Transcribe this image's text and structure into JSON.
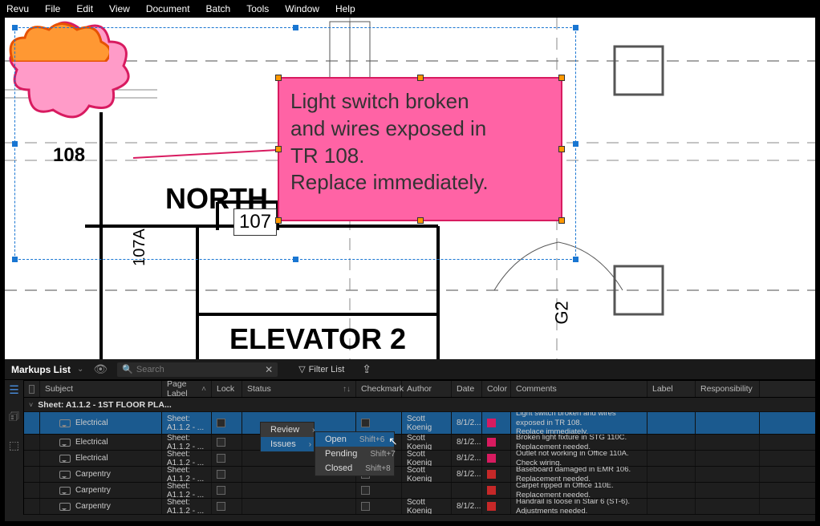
{
  "menu": [
    "Revu",
    "File",
    "Edit",
    "View",
    "Document",
    "Batch",
    "Tools",
    "Window",
    "Help"
  ],
  "canvas": {
    "cloud_label": "108",
    "label_107": "107",
    "label_107a": "107A",
    "label_north": "NORTH I",
    "label_elevator": "ELEVATOR 2",
    "label_g2": "G2",
    "callout_text_l1": "Light switch broken",
    "callout_text_l2": "and wires exposed in",
    "callout_text_l3": "TR 108.",
    "callout_text_l4": "Replace immediately."
  },
  "panel": {
    "title": "Markups List",
    "search_placeholder": "Search",
    "filter_label": "Filter List",
    "columns": {
      "subject": "Subject",
      "page": "Page Label",
      "lock": "Lock",
      "status": "Status",
      "checkmark": "Checkmark",
      "author": "Author",
      "date": "Date",
      "color": "Color",
      "comments": "Comments",
      "label": "Label",
      "responsibility": "Responsibility"
    },
    "group_label": "Sheet: A1.1.2 - 1ST FLOOR PLA...",
    "rows": [
      {
        "subject": "Electrical",
        "page": "Sheet: A1.1.2 - ...",
        "author": "Scott Koenig",
        "date": "8/1/2...",
        "color": "#d81b60",
        "comments": "Light switch broken and wires exposed in TR 108.\nReplace immediately."
      },
      {
        "subject": "Electrical",
        "page": "Sheet: A1.1.2 - ...",
        "author": "Scott Koenig",
        "date": "8/1/2...",
        "color": "#d81b60",
        "comments": "Broken light fixture in STG 110C. Replacement needed."
      },
      {
        "subject": "Electrical",
        "page": "Sheet: A1.1.2 - ...",
        "author": "Scott Koenig",
        "date": "8/1/2...",
        "color": "#d81b60",
        "comments": "Outlet not working in Office 110A. Check wiring."
      },
      {
        "subject": "Carpentry",
        "page": "Sheet: A1.1.2 - ...",
        "author": "Scott Koenig",
        "date": "8/1/2...",
        "color": "#c62828",
        "comments": "Baseboard damaged in EMR 106. Replacement needed."
      },
      {
        "subject": "Carpentry",
        "page": "Sheet: A1.1.2 - ...",
        "author": "",
        "date": "",
        "color": "#c62828",
        "comments": "Carpet ripped in Office 110E. Replacement needed."
      },
      {
        "subject": "Carpentry",
        "page": "Sheet: A1.1.2 - ...",
        "author": "Scott Koenig",
        "date": "8/1/2...",
        "color": "#c62828",
        "comments": "Handrail is loose in Stair 6 (ST-6). Adjustments needed."
      }
    ],
    "context_menu": {
      "review": "Review",
      "issues": "Issues",
      "sub": [
        {
          "label": "Open",
          "shortcut": "Shift+6"
        },
        {
          "label": "Pending",
          "shortcut": "Shift+7"
        },
        {
          "label": "Closed",
          "shortcut": "Shift+8"
        }
      ]
    }
  }
}
